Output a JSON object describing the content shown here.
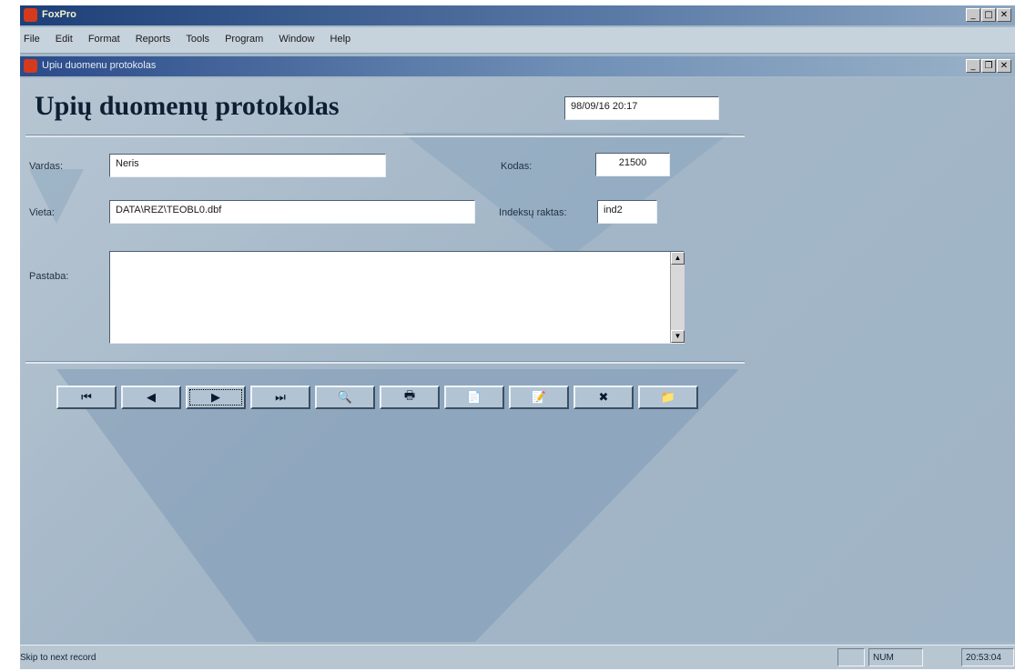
{
  "window": {
    "title": "FoxPro",
    "child_title": "Upiu duomenu protokolas"
  },
  "menu": [
    "File",
    "Edit",
    "Format",
    "Reports",
    "Tools",
    "Program",
    "Window",
    "Help"
  ],
  "form": {
    "heading": "Upių duomenų protokolas",
    "datetime": "98/09/16 20:17",
    "labels": {
      "name": "Vardas:",
      "code": "Kodas:",
      "location": "Vieta:",
      "indices": "Indeksų raktas:",
      "note": "Pastaba:"
    },
    "values": {
      "name": "Neris",
      "code": "21500",
      "location": "DATA\\REZ\\TEOBL0.dbf",
      "indices": "ind2",
      "note": ""
    }
  },
  "nav_buttons": [
    {
      "name": "first-record-button",
      "glyph": "⏮"
    },
    {
      "name": "previous-record-button",
      "glyph": "◀"
    },
    {
      "name": "next-record-button",
      "glyph": "▶"
    },
    {
      "name": "last-record-button",
      "glyph": "⏭"
    },
    {
      "name": "find-button",
      "glyph": "🔍"
    },
    {
      "name": "print-button",
      "glyph": "🖶"
    },
    {
      "name": "new-record-button",
      "glyph": "📄"
    },
    {
      "name": "edit-record-button",
      "glyph": "📝"
    },
    {
      "name": "delete-record-button",
      "glyph": "✖"
    },
    {
      "name": "exit-button",
      "glyph": "📁"
    }
  ],
  "status": {
    "message": "Skip to next record",
    "num": "NUM",
    "time": "20:53:04"
  }
}
